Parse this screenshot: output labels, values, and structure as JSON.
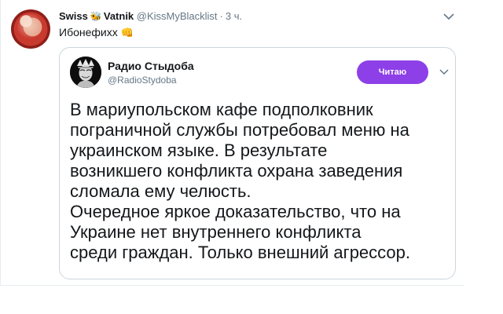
{
  "tweet": {
    "author_name": "Swiss",
    "author_name_suffix": "Vatnik",
    "handle": "@KissMyBlacklist",
    "separator": "·",
    "time": "3 ч.",
    "text": "Ибонефихх",
    "emoji": "👊",
    "avatar_icon": "profile-photo"
  },
  "quoted_tweet": {
    "author_name": "Радио Стыдоба",
    "handle": "@RadioStydoba",
    "follow_label": "Читаю",
    "accent_color": "#8d3fe8",
    "avatar_icon": "statue-of-liberty-profile-photo",
    "body_lines": [
      "В мариупольском кафе подполковник",
      "пограничной службы потребовал меню на",
      "украинском языке. В результате",
      "возникшего конфликта охрана заведения",
      "сломала ему челюсть.",
      "Очередное яркое доказательство, что на",
      "Украине нет внутреннего конфликта",
      "среди граждан. Только внешний агрессор."
    ]
  },
  "icons": {
    "menu": "chevron-down-icon",
    "bee": "bee-icon"
  }
}
